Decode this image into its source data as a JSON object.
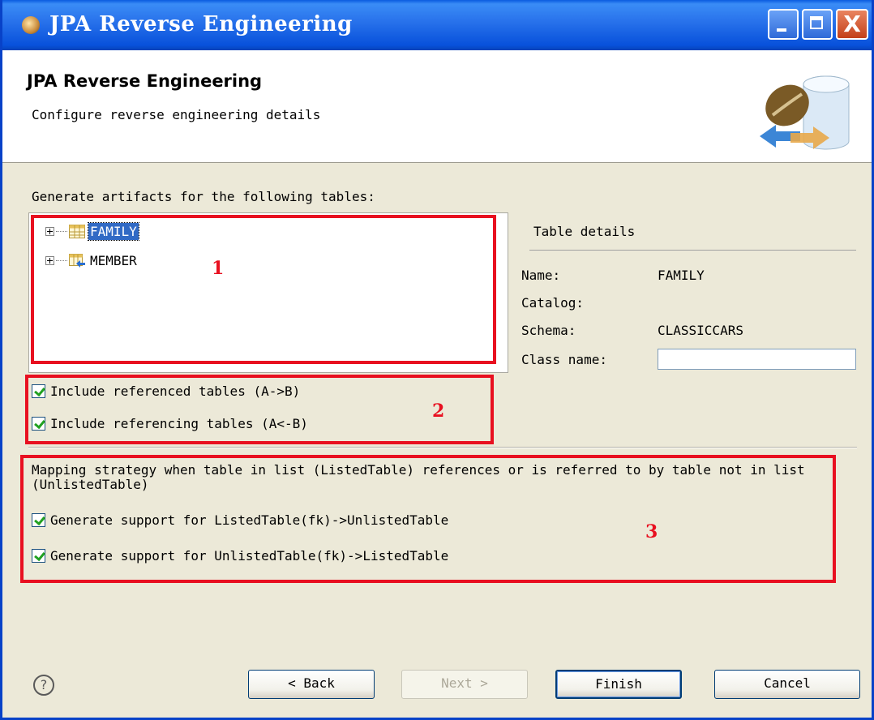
{
  "window": {
    "title": "JPA Reverse Engineering",
    "close_glyph": "X",
    "app_icon": "jpa-app-icon"
  },
  "header": {
    "title": "JPA Reverse Engineering",
    "subtitle": "Configure reverse engineering details",
    "graphic_icon": "bean-database-icon"
  },
  "tables": {
    "prompt": "Generate artifacts for the following tables:",
    "items": [
      {
        "label": "FAMILY",
        "selected": true,
        "icon": "table-icon"
      },
      {
        "label": "MEMBER",
        "selected": false,
        "icon": "table-reference-icon"
      }
    ]
  },
  "details": {
    "title": "Table details",
    "name_label": "Name:",
    "name_value": "FAMILY",
    "catalog_label": "Catalog:",
    "catalog_value": "",
    "schema_label": "Schema:",
    "schema_value": "CLASSICCARS",
    "class_name_label": "Class name:",
    "class_name_value": ""
  },
  "options": {
    "include_referenced": "Include referenced tables (A->B)",
    "include_referencing": "Include referencing tables (A<-B)"
  },
  "mapping": {
    "description": "Mapping strategy when table in list (ListedTable) references or is referred to by table not in list (UnlistedTable)",
    "option1": "Generate support for ListedTable(fk)->UnlistedTable",
    "option2": "Generate support for UnlistedTable(fk)->ListedTable"
  },
  "annotations": [
    "1",
    "2",
    "3"
  ],
  "footer": {
    "help_glyph": "?",
    "back": "< Back",
    "next": "Next >",
    "finish": "Finish",
    "cancel": "Cancel"
  },
  "colors": {
    "titlebar": "#0a5be0",
    "annotation_red": "#e81020",
    "selection": "#316ac5",
    "check_green": "#21a121"
  }
}
